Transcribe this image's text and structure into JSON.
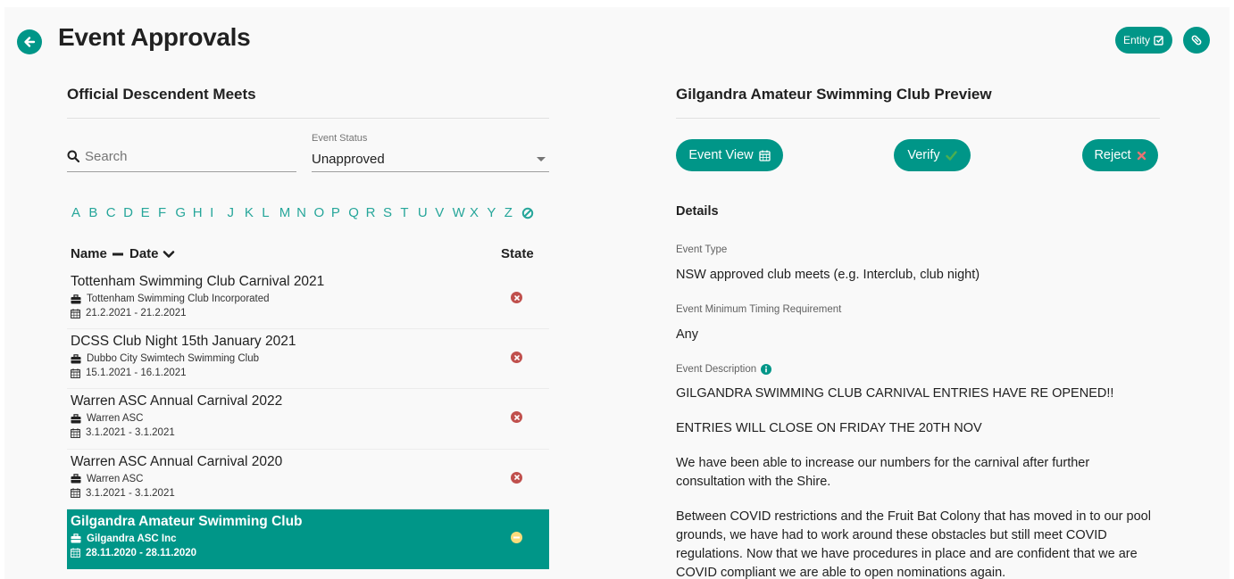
{
  "header": {
    "title": "Event Approvals",
    "entity_label": "Entity"
  },
  "left": {
    "title": "Official Descendent Meets",
    "search_placeholder": "Search",
    "status_label": "Event Status",
    "status_value": "Unapproved",
    "alphabet": [
      "A",
      "B",
      "C",
      "D",
      "E",
      "F",
      "G",
      "H",
      "I",
      "J",
      "K",
      "L",
      "M",
      "N",
      "O",
      "P",
      "Q",
      "R",
      "S",
      "T",
      "U",
      "V",
      "W",
      "X",
      "Y",
      "Z"
    ],
    "columns": {
      "name": "Name",
      "date": "Date",
      "state": "State"
    },
    "rows": [
      {
        "title": "Tottenham Swimming Club Carnival 2021",
        "club": "Tottenham Swimming Club Incorporated",
        "dates": "21.2.2021 - 21.2.2021",
        "state": "rejected"
      },
      {
        "title": "DCSS Club Night 15th January 2021",
        "club": "Dubbo City Swimtech Swimming Club",
        "dates": "15.1.2021 - 16.1.2021",
        "state": "rejected"
      },
      {
        "title": "Warren ASC Annual Carnival 2022",
        "club": "Warren ASC",
        "dates": "3.1.2021 - 3.1.2021",
        "state": "rejected"
      },
      {
        "title": "Warren ASC Annual Carnival 2020",
        "club": "Warren ASC",
        "dates": "3.1.2021 - 3.1.2021",
        "state": "rejected"
      },
      {
        "title": "Gilgandra Amateur Swimming Club",
        "club": "Gilgandra ASC Inc",
        "dates": "28.11.2020 - 28.11.2020",
        "state": "pending",
        "selected": true
      }
    ]
  },
  "right": {
    "title": "Gilgandra Amateur Swimming Club Preview",
    "event_view_label": "Event View",
    "verify_label": "Verify",
    "reject_label": "Reject",
    "details_title": "Details",
    "event_type_label": "Event Type",
    "event_type_value": "NSW approved club meets (e.g. Interclub, club night)",
    "timing_label": "Event Minimum Timing Requirement",
    "timing_value": "Any",
    "description_label": "Event Description",
    "description": [
      "GILGANDRA SWIMMING CLUB CARNIVAL ENTRIES HAVE RE OPENED!!",
      "ENTRIES WILL CLOSE ON FRIDAY THE 20TH NOV",
      "We have been able to increase our numbers for the carnival after further consultation with the Shire.",
      "Between COVID restrictions and the Fruit Bat Colony that has moved in to our pool grounds, we have had to work around these obstacles but still meet COVID regulations. Now that we have procedures in place and are confident that we are COVID compliant we are able to open nominations again."
    ]
  },
  "colors": {
    "accent": "#009688",
    "letters": "#26a69a",
    "rejected": "#c0504d",
    "pending": "#fbdc7c",
    "verify_check": "#4caf50",
    "reject_x": "#e57373"
  }
}
